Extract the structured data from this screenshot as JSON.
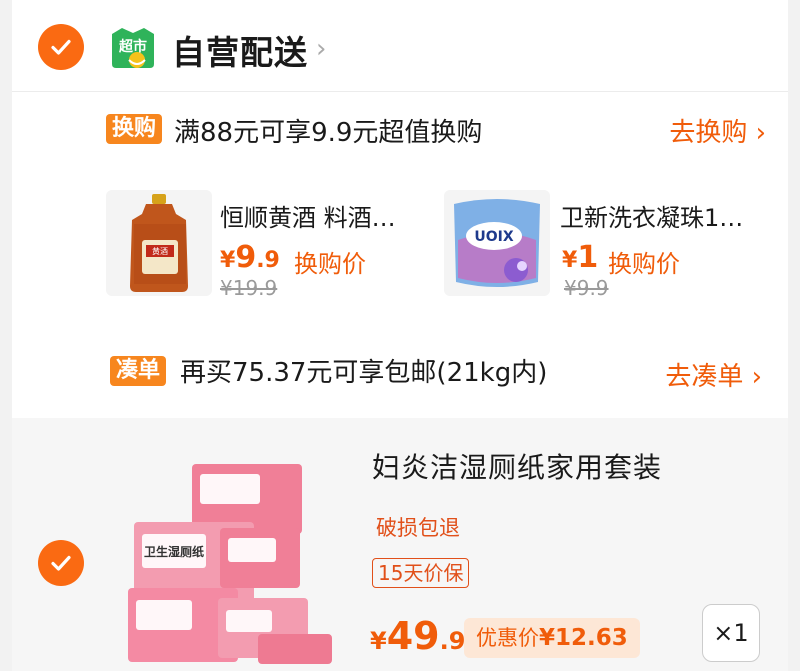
{
  "store": {
    "logo_text": "超市",
    "title": "自营配送",
    "chevron": "›",
    "check_icon": "check-circle-icon",
    "accent": "#fa6a12"
  },
  "swap": {
    "tag": "换购",
    "text": "满88元可享9.9元超值换购",
    "link": "去换购 ›",
    "products": [
      {
        "name": "恒顺黄酒 料酒…",
        "price_symbol": "¥",
        "price_int": "9",
        "price_dec": ".9",
        "price_label": "换购价",
        "original_price": "¥19.9",
        "image_label": "黄酒"
      },
      {
        "name": "卫新洗衣凝珠1…",
        "price_symbol": "¥",
        "price_int": "1",
        "price_dec": "",
        "price_label": "换购价",
        "original_price": "¥9.9",
        "image_label": "UOIX"
      }
    ]
  },
  "bundle": {
    "tag": "凑单",
    "text": "再买75.37元可享包邮(21kg内)",
    "link": "去凑单 ›"
  },
  "item": {
    "title": "妇炎洁湿厕纸家用套装",
    "note": "破损包退",
    "badge": "15天价保",
    "price_symbol": "¥",
    "price_int": "49",
    "price_dec": ".9",
    "discount_label": "优惠价",
    "discount_price": "¥12.63",
    "quantity": "×1",
    "image_label": "卫生湿厕纸"
  }
}
